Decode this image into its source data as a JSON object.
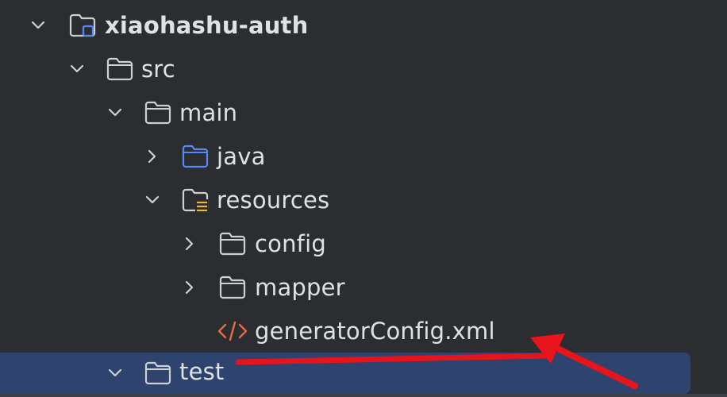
{
  "tree": {
    "items": [
      {
        "label": "xiaohashu-auth",
        "icon": "module-folder-icon",
        "expanded": true
      },
      {
        "label": "src",
        "icon": "folder-icon",
        "expanded": true
      },
      {
        "label": "main",
        "icon": "folder-icon",
        "expanded": true
      },
      {
        "label": "java",
        "icon": "source-folder-icon",
        "expanded": false
      },
      {
        "label": "resources",
        "icon": "resources-folder-icon",
        "expanded": true
      },
      {
        "label": "config",
        "icon": "folder-icon",
        "expanded": false
      },
      {
        "label": "mapper",
        "icon": "folder-icon",
        "expanded": false
      },
      {
        "label": "generatorConfig.xml",
        "icon": "xml-file-icon"
      },
      {
        "label": "test",
        "icon": "folder-icon",
        "expanded": true,
        "selected": true
      }
    ]
  },
  "colors": {
    "background": "#2b2d30",
    "text": "#dfe1e5",
    "selection": "#2e436e",
    "icon_stroke": "#ced0d6",
    "source_folder": "#548af7",
    "resources_accent": "#e5b647",
    "xml_icon": "#e06c4a",
    "annotation": "#e8141b"
  }
}
